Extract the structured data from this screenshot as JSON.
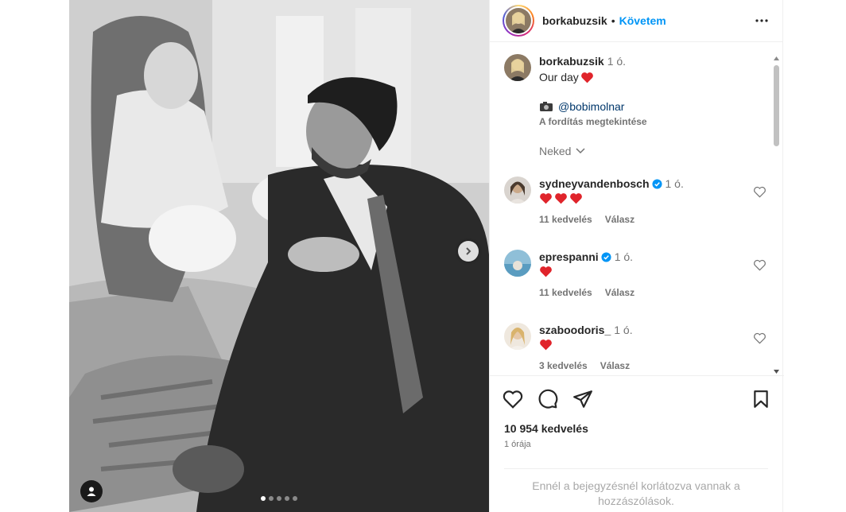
{
  "post": {
    "author": "borkabuzsik",
    "separator": "•",
    "follow_label": "Követem"
  },
  "caption": {
    "username": "borkabuzsik",
    "time": "1 ó.",
    "text": "Our day",
    "credit": "@bobimolnar",
    "translate_label": "A fordítás megtekintése",
    "hide_replies_label": "Neked"
  },
  "comments": [
    {
      "username": "sydneyvandenbosch",
      "time": "1 ó.",
      "hearts": 3,
      "verified": true,
      "likes": "11 kedvelés",
      "reply": "Válasz"
    },
    {
      "username": "eprespanni",
      "time": "1 ó.",
      "hearts": 1,
      "verified": true,
      "likes": "11 kedvelés",
      "reply": "Válasz"
    },
    {
      "username": "szaboodoris_",
      "time": "1 ó.",
      "hearts": 1,
      "verified": false,
      "likes": "3 kedvelés",
      "reply": "Válasz"
    }
  ],
  "stats": {
    "likes": "10 954 kedvelés",
    "ago": "1 órája"
  },
  "restricted_text": "Ennél a bejegyzésnél korlátozva vannak a hozzászólások.",
  "colors": {
    "accent": "#0095f6",
    "heart": "#ff3040",
    "verified": "#0095f6"
  },
  "carousel": {
    "total_slides": 5,
    "current_slide": 1
  }
}
